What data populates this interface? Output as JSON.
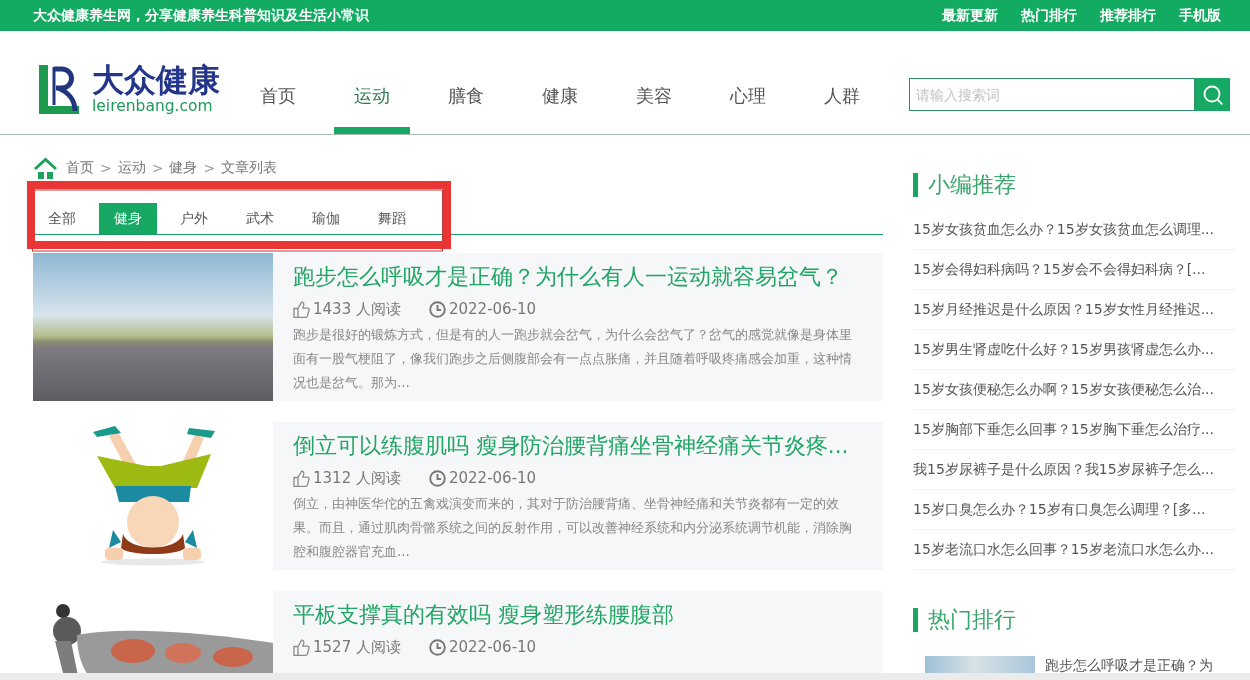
{
  "top_bar": {
    "tagline": "大众健康养生网，分享健康养生科普知识及生活小常识",
    "links": [
      {
        "label": "最新更新"
      },
      {
        "label": "热门排行"
      },
      {
        "label": "推荐排行"
      },
      {
        "label": "手机版"
      }
    ]
  },
  "header": {
    "logo": {
      "name": "大众健康",
      "domain": "leirenbang.com"
    },
    "nav": [
      {
        "label": "首页",
        "selected": false
      },
      {
        "label": "运动",
        "selected": true
      },
      {
        "label": "膳食",
        "selected": false
      },
      {
        "label": "健康",
        "selected": false
      },
      {
        "label": "美容",
        "selected": false
      },
      {
        "label": "心理",
        "selected": false
      },
      {
        "label": "人群",
        "selected": false
      }
    ],
    "search": {
      "placeholder": "请输入搜索词"
    }
  },
  "breadcrumb": {
    "separator": ">",
    "items": [
      "首页",
      "运动",
      "健身",
      "文章列表"
    ]
  },
  "annotation": {
    "kind": "frame"
  },
  "tabs": [
    {
      "label": "全部",
      "selected": false
    },
    {
      "label": "健身",
      "selected": true
    },
    {
      "label": "户外",
      "selected": false
    },
    {
      "label": "武术",
      "selected": false
    },
    {
      "label": "瑜伽",
      "selected": false
    },
    {
      "label": "舞蹈",
      "selected": false
    }
  ],
  "articles": [
    {
      "image": {
        "kind": "photo"
      },
      "title": "跑步怎么呼吸才是正确？为什么有人一运动就容易岔气？",
      "views": "1433 人阅读",
      "date": "2022-06-10",
      "excerpt": "跑步是很好的锻炼方式，但是有的人一跑步就会岔气，为什么会岔气了？岔气的感觉就像是身体里面有一股气梗阻了，像我们跑步之后侧腹部会有一点点胀痛，并且随着呼吸疼痛感会加重，这种情况也是岔气。那为..."
    },
    {
      "image": {
        "kind": "handstand"
      },
      "title": "倒立可以练腹肌吗 瘦身防治腰背痛坐骨神经痛关节炎疼...",
      "views": "1312 人阅读",
      "date": "2022-06-10",
      "excerpt": "倒立，由神医华佗的五禽戏演变而来的，其对于防治腰背痛、坐骨神经痛和关节炎都有一定的效果。而且，通过肌肉骨骼系统之间的反射作用，可以改善神经系统和内分泌系统调节机能，消除胸腔和腹腔器官充血..."
    },
    {
      "image": {
        "kind": "plank"
      },
      "title": "平板支撑真的有效吗 瘦身塑形练腰腹部",
      "views": "1527 人阅读",
      "date": "2022-06-10"
    }
  ],
  "sidebar": {
    "sections": [
      {
        "title": "小编推荐",
        "kind": "list",
        "items": [
          "15岁女孩贫血怎么办？15岁女孩贫血怎么调理...",
          "15岁会得妇科病吗？15岁会不会得妇科病？[...",
          "15岁月经推迟是什么原因？15岁女性月经推迟...",
          "15岁男生肾虚吃什么好？15岁男孩肾虚怎么办...",
          "15岁女孩便秘怎么办啊？15岁女孩便秘怎么治...",
          "15岁胸部下垂怎么回事？15岁胸下垂怎么治疗...",
          "我15岁尿裤子是什么原因？我15岁尿裤子怎么...",
          "15岁口臭怎么办？15岁有口臭怎么调理？[多...",
          "15岁老流口水怎么回事？15岁老流口水怎么办..."
        ]
      },
      {
        "title": "热门排行",
        "kind": "thumbs",
        "items": [
          "跑步怎么呼吸才是正确？为"
        ]
      }
    ]
  }
}
